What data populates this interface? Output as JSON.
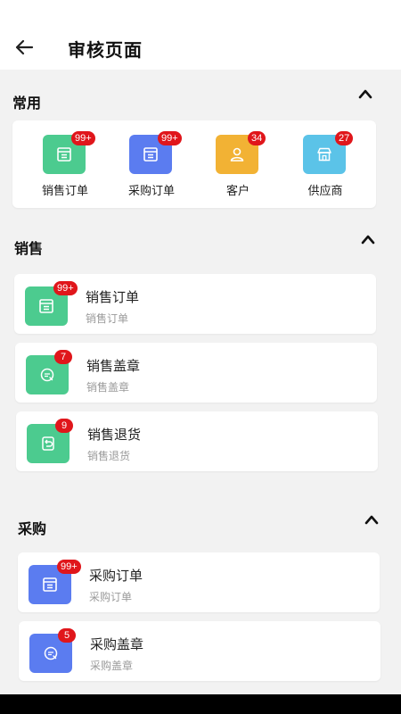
{
  "header": {
    "title": "审核页面",
    "back_icon": "arrow-left-icon"
  },
  "sections": {
    "common": {
      "title": "常用",
      "items": [
        {
          "label": "销售订单",
          "badge": "99+",
          "color": "#4ccb8f",
          "icon": "order-box-icon"
        },
        {
          "label": "采购订单",
          "badge": "99+",
          "color": "#5b7cf0",
          "icon": "order-box-icon"
        },
        {
          "label": "客户",
          "badge": "34",
          "color": "#f2b234",
          "icon": "customer-icon"
        },
        {
          "label": "供应商",
          "badge": "27",
          "color": "#5bc3e8",
          "icon": "store-icon"
        }
      ]
    },
    "sales": {
      "title": "销售",
      "items": [
        {
          "title": "销售订单",
          "subtitle": "销售订单",
          "badge": "99+",
          "color": "#4ccb8f",
          "icon": "order-box-icon"
        },
        {
          "title": "销售盖章",
          "subtitle": "销售盖章",
          "badge": "7",
          "color": "#4ccb8f",
          "icon": "stamp-icon"
        },
        {
          "title": "销售退货",
          "subtitle": "销售退货",
          "badge": "9",
          "color": "#4ccb8f",
          "icon": "return-icon"
        }
      ]
    },
    "purchase": {
      "title": "采购",
      "items": [
        {
          "title": "采购订单",
          "subtitle": "采购订单",
          "badge": "99+",
          "color": "#5b7cf0",
          "icon": "order-box-icon"
        },
        {
          "title": "采购盖章",
          "subtitle": "采购盖章",
          "badge": "5",
          "color": "#5b7cf0",
          "icon": "stamp-icon"
        }
      ]
    }
  }
}
